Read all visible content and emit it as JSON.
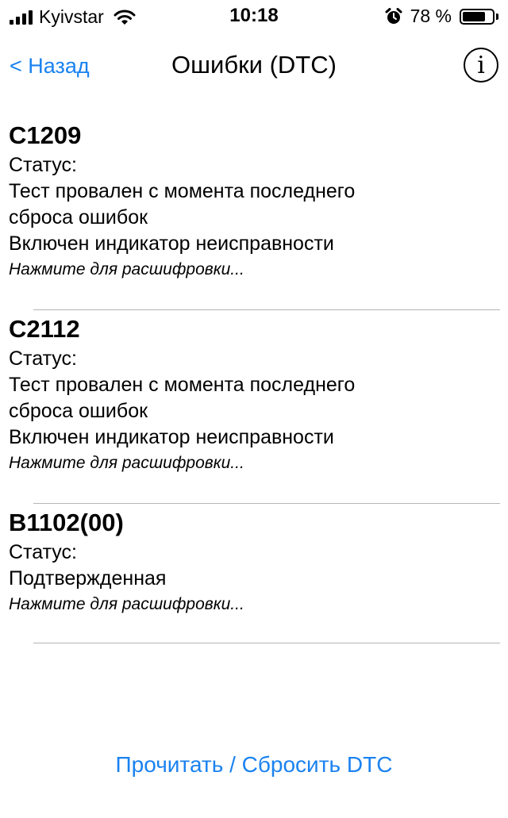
{
  "status_bar": {
    "carrier": "Kyivstar",
    "time": "10:18",
    "battery_percent": "78 %",
    "battery_level": 0.78,
    "signal_bars": 4,
    "icons": [
      "signal-bars-icon",
      "wifi-icon",
      "alarm-clock-icon",
      "battery-icon"
    ]
  },
  "nav": {
    "back_label": "< Назад",
    "title": "Ошибки (DTC)",
    "info_label": "i"
  },
  "dtc_items": [
    {
      "code": "C1209",
      "status_label": "Статус:",
      "status_lines": [
        "Тест провален с момента последнего",
        "сброса ошибок",
        "Включен индикатор неисправности"
      ],
      "hint": "Нажмите для расшифровки..."
    },
    {
      "code": "C2112",
      "status_label": "Статус:",
      "status_lines": [
        "Тест провален с момента последнего",
        "сброса ошибок",
        "Включен индикатор неисправности"
      ],
      "hint": "Нажмите для расшифровки..."
    },
    {
      "code": "B1102(00)",
      "status_label": "Статус:",
      "status_lines": [
        "Подтвержденная"
      ],
      "hint": "Нажмите для расшифровки..."
    }
  ],
  "bottom_button": "Прочитать / Сбросить DTC",
  "colors": {
    "accent": "#1a82f0",
    "separator": "#b5b5b5"
  }
}
